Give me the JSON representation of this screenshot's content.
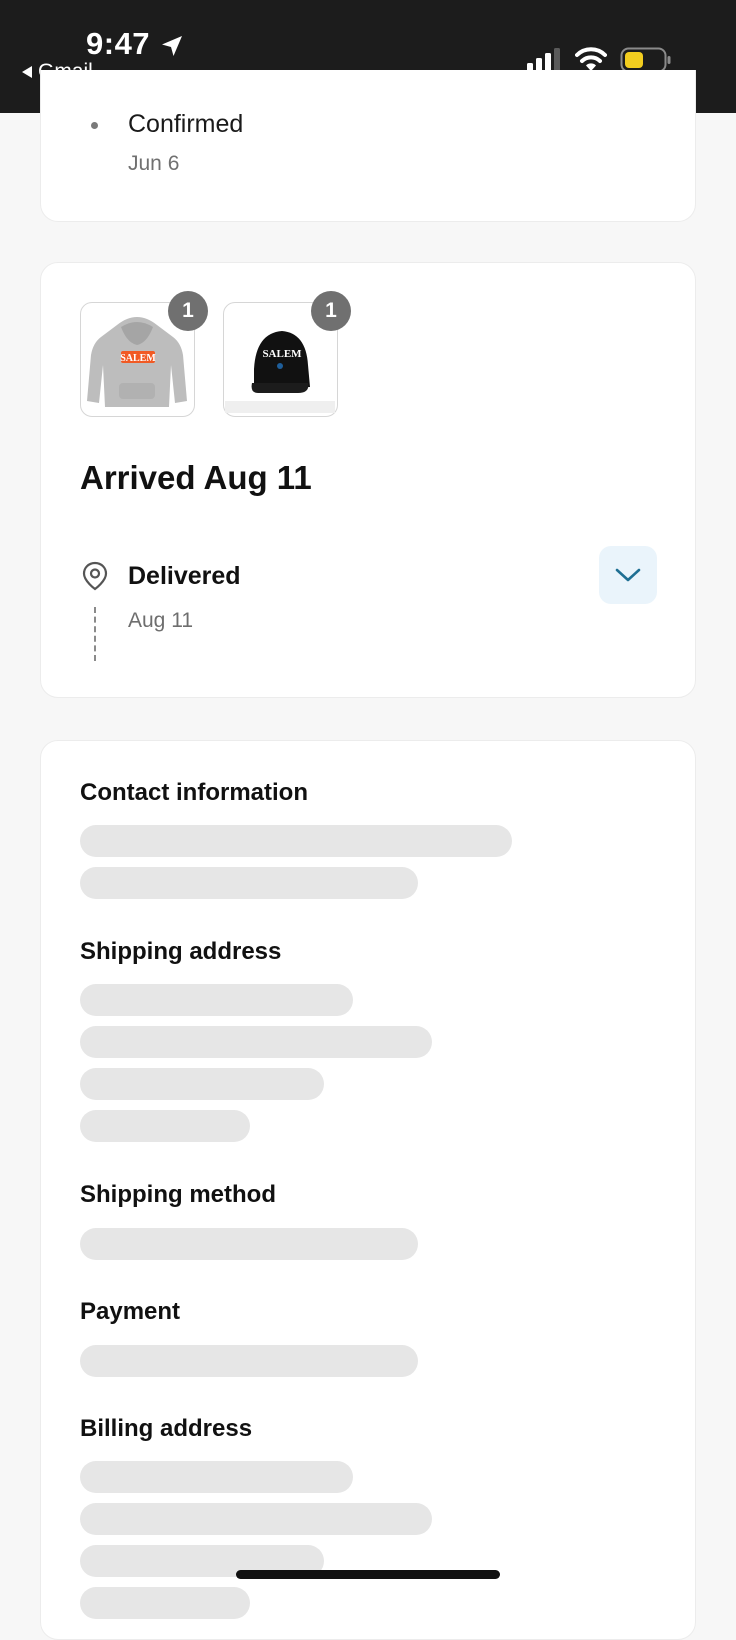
{
  "status_bar": {
    "time": "9:47",
    "back_app": "Gmail"
  },
  "timeline": {
    "event_title": "Confirmed",
    "event_date": "Jun 6"
  },
  "order": {
    "items": [
      {
        "name": "hoodie",
        "quantity": "1"
      },
      {
        "name": "cap",
        "quantity": "1"
      }
    ],
    "arrival_heading": "Arrived Aug 11",
    "status_label": "Delivered",
    "status_date": "Aug 11"
  },
  "details": {
    "contact_title": "Contact information",
    "shipping_address_title": "Shipping address",
    "shipping_method_title": "Shipping method",
    "payment_title": "Payment",
    "billing_address_title": "Billing address"
  },
  "colors": {
    "accent": "#1f6f93",
    "skeleton": "#e6e6e6",
    "expand_bg": "#eaf4fb",
    "battery_low": "#f2cd1f"
  }
}
